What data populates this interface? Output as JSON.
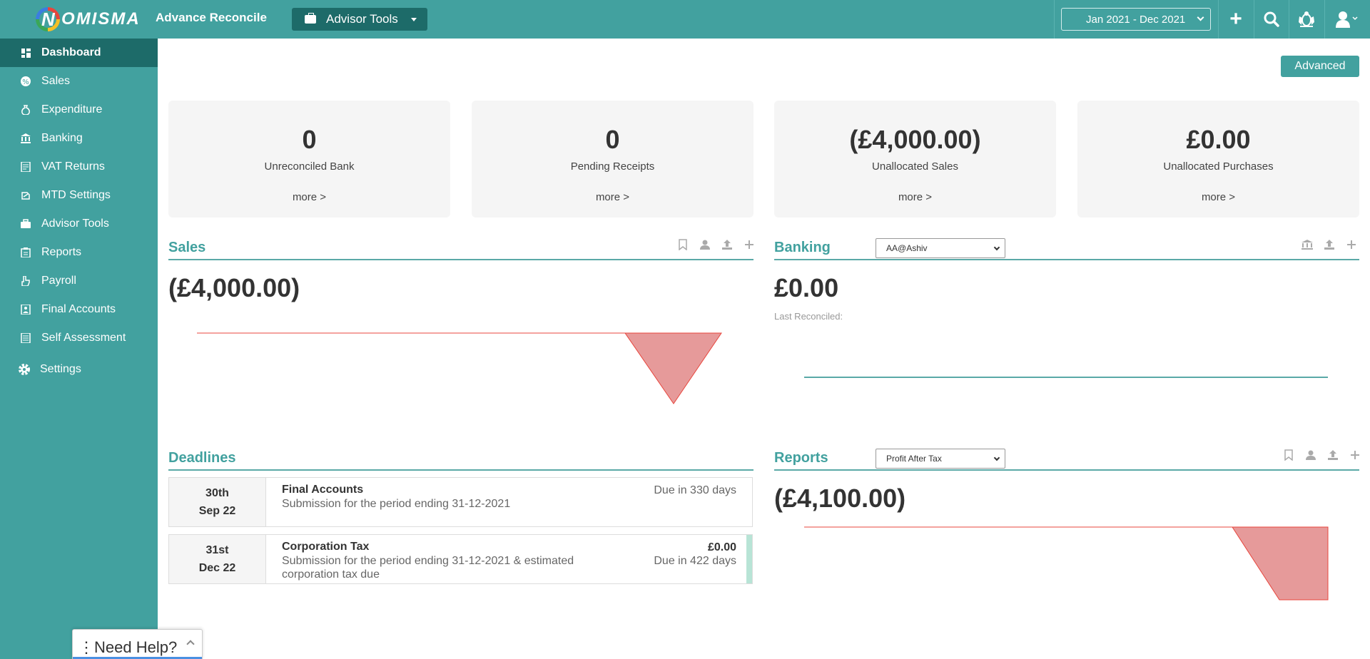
{
  "topbar": {
    "logo_letter": "N",
    "logo_text": "OMISMA",
    "app_title": "Advance Reconcile",
    "advisor_tools_label": "Advisor Tools",
    "date_range": "Jan 2021 - Dec 2021",
    "bg_color": "#42a19f",
    "icons": [
      "plus-icon",
      "search-icon",
      "crest-icon",
      "user-icon"
    ]
  },
  "sidebar": {
    "items": [
      {
        "label": "Dashboard",
        "icon": "dashboard-icon",
        "active": true
      },
      {
        "label": "Sales",
        "icon": "sales-icon"
      },
      {
        "label": "Expenditure",
        "icon": "money-bag-icon"
      },
      {
        "label": "Banking",
        "icon": "bank-icon"
      },
      {
        "label": "VAT Returns",
        "icon": "vat-icon"
      },
      {
        "label": "MTD Settings",
        "icon": "mtd-icon"
      },
      {
        "label": "Advisor Tools",
        "icon": "briefcase-icon"
      },
      {
        "label": "Reports",
        "icon": "clipboard-icon"
      },
      {
        "label": "Payroll",
        "icon": "payroll-icon"
      },
      {
        "label": "Final Accounts",
        "icon": "final-accounts-icon"
      },
      {
        "label": "Self Assessment",
        "icon": "self-assessment-icon"
      },
      {
        "label": "Settings",
        "icon": "gear-icon"
      }
    ]
  },
  "main": {
    "advanced_label": "Advanced",
    "cards": [
      {
        "value": "0",
        "label": "Unreconciled Bank",
        "more": "more >"
      },
      {
        "value": "0",
        "label": "Pending Receipts",
        "more": "more >"
      },
      {
        "value": "(£4,000.00)",
        "label": "Unallocated Sales",
        "more": "more >"
      },
      {
        "value": "£0.00",
        "label": "Unallocated Purchases",
        "more": "more >"
      }
    ],
    "sales": {
      "title": "Sales",
      "value": "(£4,000.00)"
    },
    "banking": {
      "title": "Banking",
      "account": "AA@Ashiv",
      "value": "£0.00",
      "last_reconciled": "Last Reconciled:"
    },
    "deadlines": {
      "title": "Deadlines",
      "items": [
        {
          "day": "30th",
          "month": "Sep 22",
          "title": "Final Accounts",
          "desc": "Submission for the period ending 31-12-2021",
          "amount": "",
          "due": "Due in 330 days"
        },
        {
          "day": "31st",
          "month": "Dec 22",
          "title": "Corporation Tax",
          "desc": "Submission for the period ending 31-12-2021 & estimated corporation tax due",
          "amount": "£0.00",
          "due": "Due in 422 days"
        }
      ]
    },
    "reports": {
      "title": "Reports",
      "selected": "Profit After Tax",
      "value": "(£4,100.00)"
    }
  },
  "help": {
    "label": "Need Help?"
  }
}
